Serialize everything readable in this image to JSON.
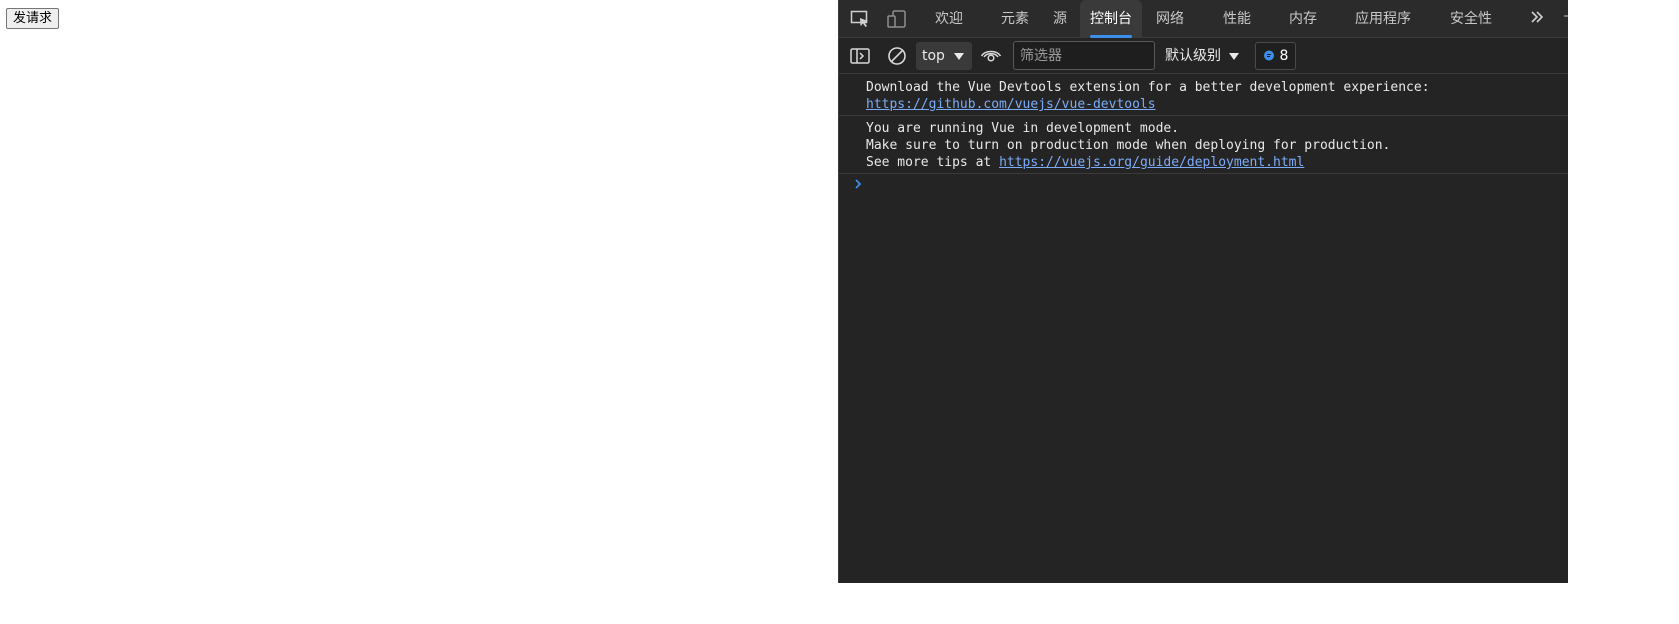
{
  "page": {
    "send_button": "发请求"
  },
  "devtools": {
    "tabs": [
      {
        "label": "欢迎"
      },
      {
        "label": "元素"
      },
      {
        "label": "源"
      },
      {
        "label": "控制台",
        "active": true
      },
      {
        "label": "网络"
      },
      {
        "label": "性能"
      },
      {
        "label": "内存"
      },
      {
        "label": "应用程序"
      },
      {
        "label": "安全性"
      }
    ],
    "toolbar": {
      "context": "top",
      "filter_placeholder": "筛选器",
      "level": "默认级别",
      "issues_count": "8"
    },
    "console": {
      "messages": [
        {
          "lines": [
            "Download the Vue Devtools extension for a better development experience:"
          ],
          "link": "https://github.com/vuejs/vue-devtools"
        },
        {
          "lines": [
            "You are running Vue in development mode.",
            "Make sure to turn on production mode when deploying for production.",
            "See more tips at "
          ],
          "link": "https://vuejs.org/guide/deployment.html"
        }
      ]
    },
    "colors": {
      "accent": "#3b8eea",
      "link": "#7cacf8",
      "background": "#242424"
    }
  }
}
